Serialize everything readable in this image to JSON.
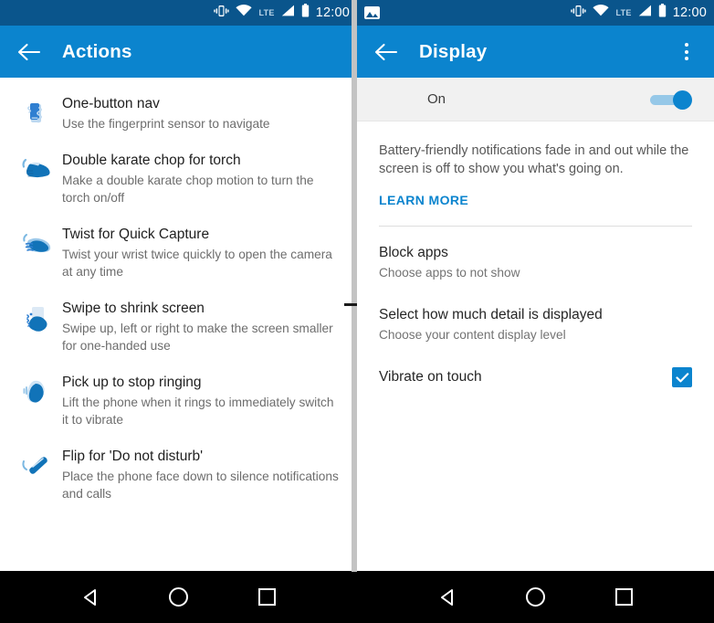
{
  "colors": {
    "statusbar": "#0a558c",
    "appbar": "#0b84ce",
    "accent": "#0b84ce",
    "navbar": "#000000",
    "toggle_row_bg": "#f1f1f1"
  },
  "left_screen": {
    "statusbar": {
      "time": "12:00",
      "network_label": "LTE",
      "icons": [
        "vibrate-icon",
        "wifi-icon",
        "lte-label",
        "signal-icon",
        "battery-icon"
      ]
    },
    "appbar": {
      "back_label": "Back",
      "title": "Actions"
    },
    "items": [
      {
        "icon": "one-button-nav-icon",
        "title": "One-button nav",
        "subtitle": "Use the fingerprint sensor to navigate"
      },
      {
        "icon": "karate-chop-icon",
        "title": "Double karate chop for torch",
        "subtitle": "Make a double karate chop motion to turn the torch on/off"
      },
      {
        "icon": "twist-wrist-icon",
        "title": "Twist for Quick Capture",
        "subtitle": "Twist your wrist twice quickly to open the camera at any time"
      },
      {
        "icon": "swipe-shrink-icon",
        "title": "Swipe to shrink screen",
        "subtitle": "Swipe up, left or right to make the screen smaller for one-handed use"
      },
      {
        "icon": "pick-up-phone-icon",
        "title": "Pick up to stop ringing",
        "subtitle": "Lift the phone when it rings to immediately switch it to vibrate"
      },
      {
        "icon": "flip-phone-icon",
        "title": "Flip for 'Do not disturb'",
        "subtitle": "Place the phone face down to silence notifications and calls"
      }
    ]
  },
  "right_screen": {
    "statusbar": {
      "time": "12:00",
      "network_label": "LTE",
      "notification_icon": "screenshot-icon",
      "icons": [
        "vibrate-icon",
        "wifi-icon",
        "lte-label",
        "signal-icon",
        "battery-icon"
      ]
    },
    "appbar": {
      "back_label": "Back",
      "title": "Display",
      "overflow_label": "More options"
    },
    "master_toggle": {
      "label": "On",
      "state": "on"
    },
    "description": "Battery-friendly notifications fade in and out while the screen is off to show you what's going on.",
    "learn_more": "LEARN MORE",
    "options": [
      {
        "title": "Block apps",
        "subtitle": "Choose apps to not show"
      },
      {
        "title": "Select how much detail is displayed",
        "subtitle": "Choose your content display level"
      }
    ],
    "checkbox_option": {
      "title": "Vibrate on touch",
      "checked": true
    }
  },
  "navbar": {
    "back_label": "Back",
    "home_label": "Home",
    "recents_label": "Recent apps"
  }
}
